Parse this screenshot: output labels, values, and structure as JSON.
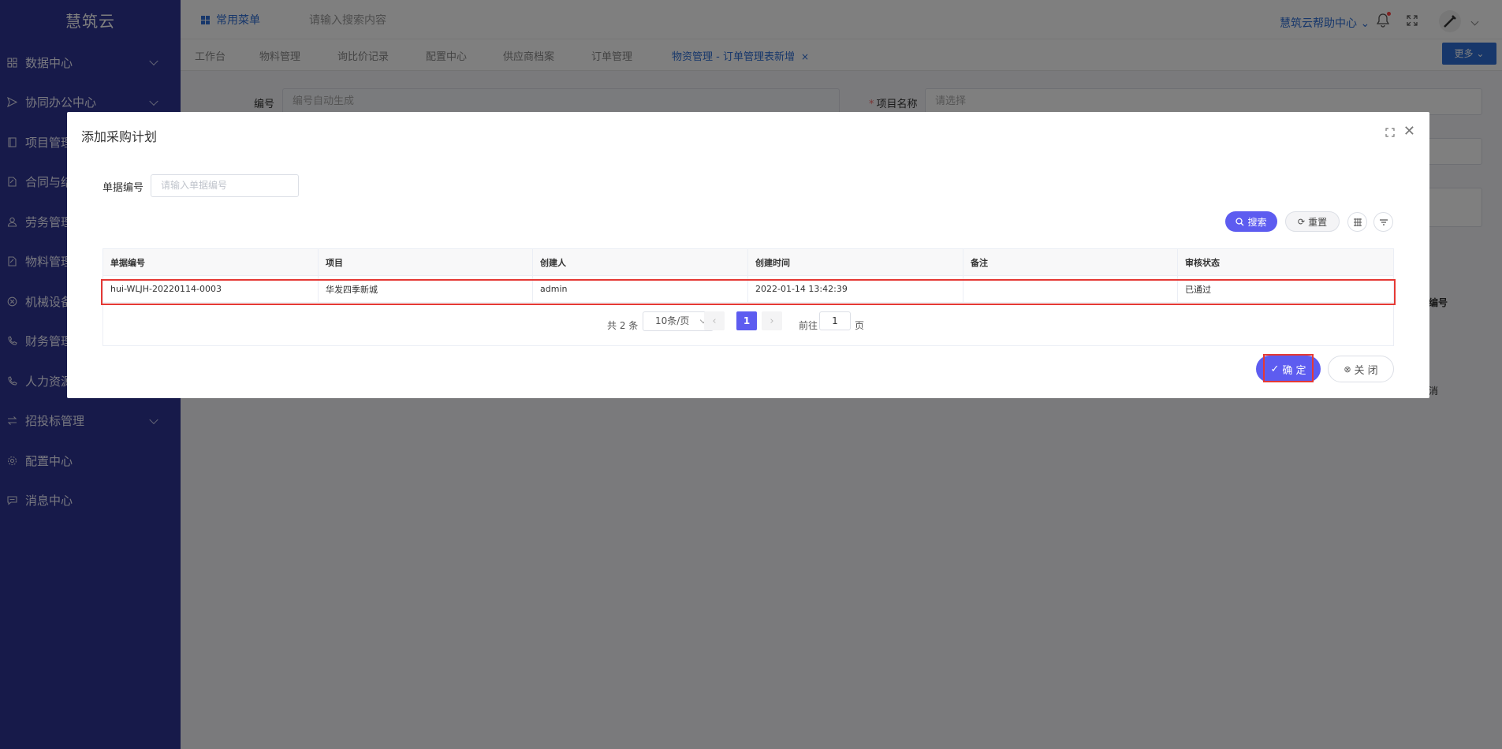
{
  "app": {
    "logo": "慧筑云"
  },
  "sidebar": {
    "items": [
      {
        "label": "数据中心",
        "icon": "grid-icon",
        "expandable": true
      },
      {
        "label": "协同办公中心",
        "icon": "send-icon",
        "expandable": true
      },
      {
        "label": "项目管理",
        "icon": "book-icon",
        "expandable": false
      },
      {
        "label": "合同与结",
        "icon": "edit-doc-icon",
        "expandable": false
      },
      {
        "label": "劳务管理",
        "icon": "user-icon",
        "expandable": false
      },
      {
        "label": "物料管理",
        "icon": "edit-doc-icon",
        "expandable": false
      },
      {
        "label": "机械设备",
        "icon": "circle-x-icon",
        "expandable": false
      },
      {
        "label": "财务管理",
        "icon": "phone-icon",
        "expandable": false
      },
      {
        "label": "人力资源",
        "icon": "phone-icon",
        "expandable": false
      },
      {
        "label": "招投标管理",
        "icon": "exchange-icon",
        "expandable": true
      },
      {
        "label": "配置中心",
        "icon": "gear-icon",
        "expandable": false
      },
      {
        "label": "消息中心",
        "icon": "message-icon",
        "expandable": false
      }
    ]
  },
  "topbar": {
    "favorites": "常用菜单",
    "search_placeholder": "请输入搜索内容",
    "help": "慧筑云帮助中心"
  },
  "tabs": {
    "items": [
      "工作台",
      "物料管理",
      "询比价记录",
      "配置中心",
      "供应商档案",
      "订单管理"
    ],
    "active": "物资管理 - 订单管理表新增",
    "close": "×",
    "more": "更多"
  },
  "background_form": {
    "number_label": "编号",
    "number_placeholder": "编号自动生成",
    "project_label": "项目名称",
    "project_placeholder": "请选择",
    "hidden_column": "编号",
    "hidden_button": "消"
  },
  "dialog": {
    "title": "添加采购计划",
    "query_label": "单据编号",
    "query_placeholder": "请输入单据编号",
    "search_button": "搜索",
    "reset_button": "重置",
    "table": {
      "columns": [
        "单据编号",
        "项目",
        "创建人",
        "创建时间",
        "备注",
        "审核状态"
      ],
      "rows": [
        [
          "hui-WLJH-20220114-0003",
          "华发四季新城",
          "admin",
          "2022-01-14 13:42:39",
          "",
          "已通过"
        ]
      ]
    },
    "pager": {
      "total": "共 2 条",
      "page_size": "10条/页",
      "current_page": "1",
      "goto_label": "前往",
      "goto_value": "1",
      "page_suffix": "页"
    },
    "confirm_button": "确 定",
    "close_button": "关 闭"
  },
  "colors": {
    "sidebar_bg": "#2f3494",
    "primary": "#5d5cf0",
    "link": "#2f6fd6",
    "highlight": "#e53935"
  }
}
